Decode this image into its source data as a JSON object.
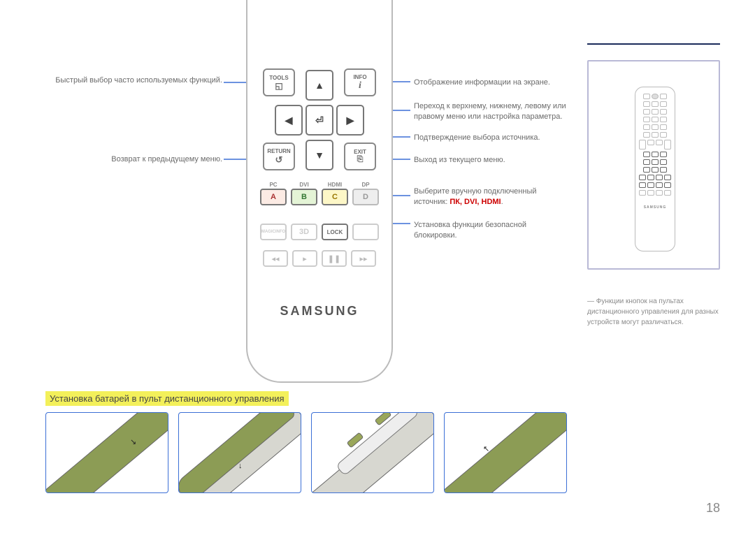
{
  "page_number": "18",
  "left_desc": {
    "tools": "Быстрый выбор часто используемых функций.",
    "return": "Возврат к предыдущему меню."
  },
  "right_desc": {
    "info": "Отображение информации на экране.",
    "navigate": "Переход к верхнему, нижнему, левому или правому меню или настройка параметра.",
    "enter": "Подтверждение выбора источника.",
    "exit": "Выход из текущего меню.",
    "source_a": "Выберите вручную подключенный источник: ",
    "source_b": "ПК, DVI, HDMI",
    "source_c": ".",
    "lock": "Установка функции безопасной блокировки."
  },
  "sidebar_note": "― Функции кнопок на пультах дистанционного управления для разных устройств могут различаться.",
  "buttons": {
    "tools": "TOOLS",
    "info": "INFO",
    "return": "RETURN",
    "exit": "EXIT",
    "lock": "LOCK",
    "d3": "3D",
    "magic": "MAGICINFO",
    "pc": "PC",
    "dvi": "DVI",
    "hdmi": "HDMI",
    "dp": "DP",
    "A": "A",
    "B": "B",
    "C": "C",
    "D": "D"
  },
  "brand": "SAMSUNG",
  "heading_battery": "Установка батарей в пульт дистанционного управления"
}
